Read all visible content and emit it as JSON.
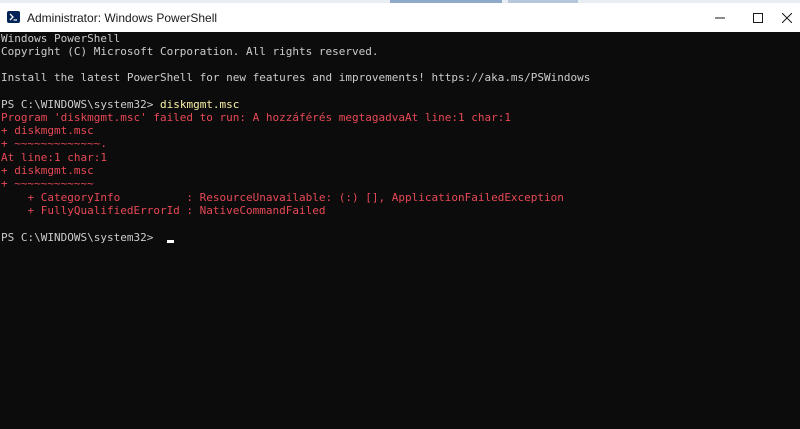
{
  "window": {
    "title": "Administrator: Windows PowerShell",
    "app_icon": "powershell-icon",
    "controls": {
      "minimize": "minimize-icon",
      "maximize": "maximize-icon",
      "close": "close-icon"
    }
  },
  "console": {
    "line1": "Windows PowerShell",
    "line2": "Copyright (C) Microsoft Corporation. All rights reserved.",
    "line3": "Install the latest PowerShell for new features and improvements! https://aka.ms/PSWindows",
    "prompt1": "PS C:\\WINDOWS\\system32> ",
    "command1": "diskmgmt.msc",
    "err1": "Program 'diskmgmt.msc' failed to run: A hozzáférés megtagadvaAt line:1 char:1",
    "err2": "+ diskmgmt.msc",
    "err3": "+ ~~~~~~~~~~~~~.",
    "err4": "At line:1 char:1",
    "err5": "+ diskmgmt.msc",
    "err6": "+ ~~~~~~~~~~~~",
    "err7": "    + CategoryInfo          : ResourceUnavailable: (:) [], ApplicationFailedException",
    "err8": "    + FullyQualifiedErrorId : NativeCommandFailed",
    "prompt2": "PS C:\\WINDOWS\\system32> "
  },
  "colors": {
    "background": "#0c0c0c",
    "text": "#cccccc",
    "error": "#e74856",
    "command": "#f9f1a5"
  }
}
